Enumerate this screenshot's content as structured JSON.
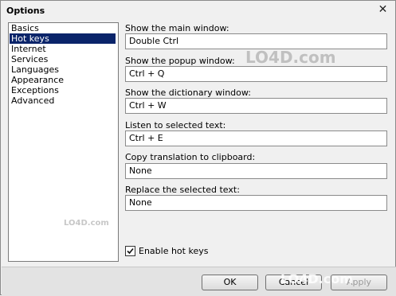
{
  "window": {
    "title": "Options",
    "close_glyph": "✕"
  },
  "categories": [
    "Basics",
    "Hot keys",
    "Internet",
    "Services",
    "Languages",
    "Appearance",
    "Exceptions",
    "Advanced"
  ],
  "selected_category": "Hot keys",
  "fields": [
    {
      "label": "Show the main window:",
      "value": "Double Ctrl"
    },
    {
      "label": "Show the popup window:",
      "value": "Ctrl + Q"
    },
    {
      "label": "Show the dictionary window:",
      "value": "Ctrl + W"
    },
    {
      "label": "Listen to selected text:",
      "value": "Ctrl + E"
    },
    {
      "label": "Copy translation to clipboard:",
      "value": "None"
    },
    {
      "label": "Replace the selected text:",
      "value": "None"
    }
  ],
  "enable_hotkeys": {
    "label": "Enable hot keys",
    "checked": true
  },
  "buttons": {
    "ok": "OK",
    "cancel": "Cancel",
    "apply": "Apply"
  },
  "watermarks": {
    "main": "LO4D.com",
    "small": "LO4D.com"
  }
}
